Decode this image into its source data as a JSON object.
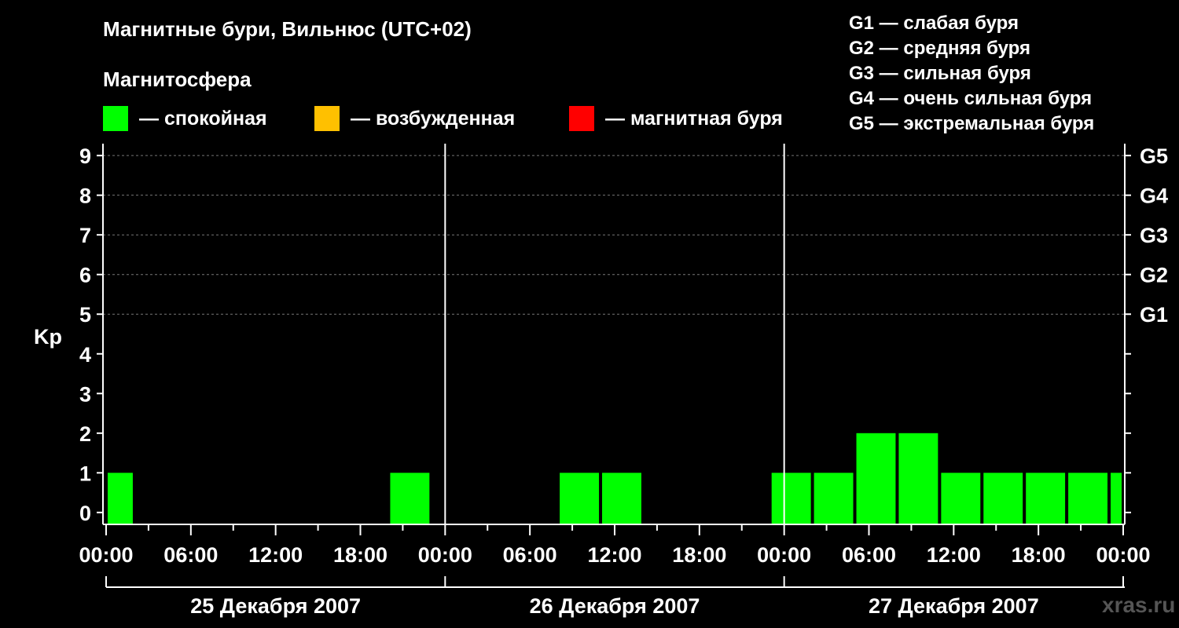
{
  "header": {
    "title": "Магнитные бури, Вильнюс (UTC+02)",
    "subtitle": "Магнитосфера"
  },
  "legend": [
    {
      "label": "— спокойная",
      "color": "#00ff00"
    },
    {
      "label": "— возбужденная",
      "color": "#ffc000"
    },
    {
      "label": "— магнитная буря",
      "color": "#ff0000"
    }
  ],
  "storm_levels": [
    "G1 — слабая буря",
    "G2 — средняя буря",
    "G3 — сильная буря",
    "G4 — очень сильная буря",
    "G5 — экстремальная буря"
  ],
  "watermark": "xras.ru",
  "chart_data": {
    "type": "bar",
    "ylabel": "Kp",
    "ylim": [
      -0.3,
      9.3
    ],
    "yticks": [
      0,
      1,
      2,
      3,
      4,
      5,
      6,
      7,
      8,
      9
    ],
    "right_ticks": [
      {
        "value": 5,
        "label": "G1"
      },
      {
        "value": 6,
        "label": "G2"
      },
      {
        "value": 7,
        "label": "G3"
      },
      {
        "value": 8,
        "label": "G4"
      },
      {
        "value": 9,
        "label": "G5"
      }
    ],
    "gridlines": [
      5,
      6,
      7,
      8,
      9
    ],
    "xlim_hours": [
      0,
      72
    ],
    "xtick_labels": [
      "00:00",
      "06:00",
      "12:00",
      "18:00",
      "00:00",
      "06:00",
      "12:00",
      "18:00",
      "00:00",
      "06:00",
      "12:00",
      "18:00",
      "00:00"
    ],
    "days": [
      "25 Декабря 2007",
      "26 Декабря 2007",
      "27 Декабря 2007"
    ],
    "colors": {
      "quiet": "#00ff00",
      "active": "#ffc000",
      "storm": "#ff0000"
    },
    "bars": [
      {
        "start": "25.12 00:00",
        "end": "25.12 02:00",
        "kp": 1
      },
      {
        "start": "25.12 20:00",
        "end": "25.12 23:00",
        "kp": 1
      },
      {
        "start": "26.12 08:00",
        "end": "26.12 11:00",
        "kp": 1
      },
      {
        "start": "26.12 11:00",
        "end": "26.12 14:00",
        "kp": 1
      },
      {
        "start": "26.12 23:00",
        "end": "27.12 02:00",
        "kp": 1
      },
      {
        "start": "27.12 02:00",
        "end": "27.12 05:00",
        "kp": 1
      },
      {
        "start": "27.12 05:00",
        "end": "27.12 08:00",
        "kp": 2
      },
      {
        "start": "27.12 08:00",
        "end": "27.12 11:00",
        "kp": 2
      },
      {
        "start": "27.12 11:00",
        "end": "27.12 14:00",
        "kp": 1
      },
      {
        "start": "27.12 14:00",
        "end": "27.12 17:00",
        "kp": 1
      },
      {
        "start": "27.12 17:00",
        "end": "27.12 20:00",
        "kp": 1
      },
      {
        "start": "27.12 20:00",
        "end": "27.12 23:00",
        "kp": 1
      },
      {
        "start": "27.12 23:00",
        "end": "28.12 00:00",
        "kp": 1
      }
    ]
  }
}
